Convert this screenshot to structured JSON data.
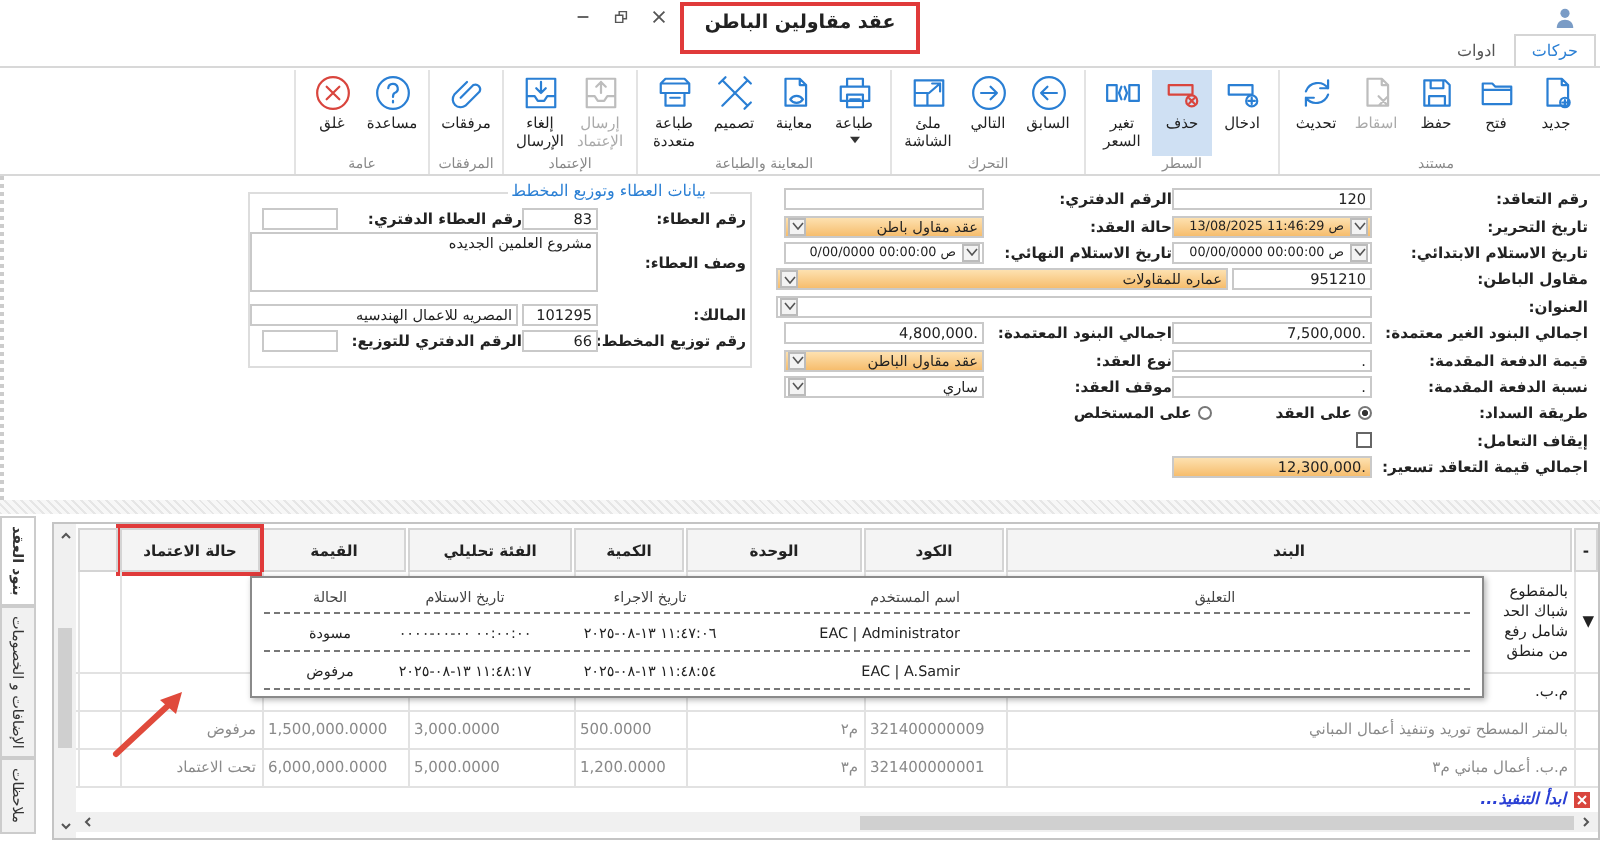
{
  "window": {
    "title": "عقد مقاولين الباطن",
    "annotated": true
  },
  "tabs": [
    {
      "label": "حركات",
      "selected": true
    },
    {
      "label": "ادوات",
      "selected": false
    }
  ],
  "ribbon": [
    {
      "label": "مستند",
      "buttons": [
        {
          "kind": "new",
          "label": "جديد",
          "selected": false,
          "disabled": false,
          "dropdown": false
        },
        {
          "kind": "open",
          "label": "فتح",
          "selected": false,
          "disabled": false,
          "dropdown": false
        },
        {
          "kind": "save",
          "label": "حفظ",
          "selected": false,
          "disabled": false,
          "dropdown": false
        },
        {
          "kind": "drop",
          "label": "اسقاط",
          "selected": false,
          "disabled": true,
          "dropdown": false
        },
        {
          "kind": "refresh",
          "label": "تحديث",
          "selected": false,
          "disabled": false,
          "dropdown": false
        }
      ]
    },
    {
      "label": "السطر",
      "buttons": [
        {
          "kind": "insert",
          "label": "ادخال",
          "selected": false,
          "disabled": false,
          "dropdown": false
        },
        {
          "kind": "delete",
          "label": "حذف",
          "selected": true,
          "disabled": false,
          "dropdown": false
        },
        {
          "kind": "reprice",
          "label": "تغير السعر",
          "selected": false,
          "disabled": false,
          "dropdown": false
        }
      ]
    },
    {
      "label": "التحرك",
      "buttons": [
        {
          "kind": "prev",
          "label": "السابق",
          "selected": false,
          "disabled": false,
          "dropdown": false
        },
        {
          "kind": "next",
          "label": "التالي",
          "selected": false,
          "disabled": false,
          "dropdown": false
        },
        {
          "kind": "fullscreen",
          "label": "ملئ الشاشة",
          "selected": false,
          "disabled": false,
          "dropdown": false
        }
      ]
    },
    {
      "label": "المعاينة والطباعة",
      "buttons": [
        {
          "kind": "print",
          "label": "طباعة",
          "selected": false,
          "disabled": false,
          "dropdown": true
        },
        {
          "kind": "preview",
          "label": "معاينة",
          "selected": false,
          "disabled": false,
          "dropdown": false
        },
        {
          "kind": "design",
          "label": "تصميم",
          "selected": false,
          "disabled": false,
          "dropdown": false
        },
        {
          "kind": "multiprint",
          "label": "طباعة متعددة",
          "selected": false,
          "disabled": false,
          "dropdown": false
        }
      ]
    },
    {
      "label": "الإعتماد",
      "buttons": [
        {
          "kind": "send",
          "label": "إرسال الإعتماد",
          "selected": false,
          "disabled": true,
          "dropdown": false
        },
        {
          "kind": "unsend",
          "label": "إلغاء الإرسال",
          "selected": false,
          "disabled": false,
          "dropdown": false
        }
      ]
    },
    {
      "label": "المرفقات",
      "buttons": [
        {
          "kind": "attach",
          "label": "مرفقات",
          "selected": false,
          "disabled": false,
          "dropdown": false
        }
      ]
    },
    {
      "label": "عامة",
      "buttons": [
        {
          "kind": "help",
          "label": "مساعدة",
          "selected": false,
          "disabled": false,
          "dropdown": false
        },
        {
          "kind": "close",
          "label": "غلق",
          "selected": false,
          "disabled": false,
          "dropdown": false
        }
      ]
    }
  ],
  "contract_form": {
    "rows": [
      [
        {
          "label": "رقم التعاقد:",
          "fields": [
            {
              "kind": "text",
              "value": "120",
              "required": false
            }
          ]
        },
        {
          "label": "الرقم الدفتري:",
          "fields": [
            {
              "kind": "text",
              "required": false
            }
          ]
        }
      ],
      [
        {
          "label": "تاريخ التحرير:",
          "fields": [
            {
              "kind": "date",
              "value": "13/08/2025 11:46:29 ص",
              "required": true
            }
          ]
        },
        {
          "label": "حالة العقد:",
          "fields": [
            {
              "kind": "select",
              "value": "عقد مقاول باطن",
              "required": true
            }
          ]
        }
      ],
      [
        {
          "label": "تاريخ الاستلام الابتدائي:",
          "fields": [
            {
              "kind": "date",
              "value": "00/00/0000 00:00:00 ص",
              "required": false
            }
          ]
        },
        {
          "label": "تاريخ الاستلام النهائي:",
          "fields": [
            {
              "kind": "date",
              "value": "0/00/0000 00:00:00 ص",
              "required": false
            }
          ]
        }
      ],
      [
        {
          "label": "مقاول الباطن:",
          "fields": [
            {
              "kind": "text",
              "value": "951210",
              "required": false
            },
            {
              "kind": "select",
              "value": "عماره للمقاولات",
              "required": true
            }
          ]
        }
      ],
      [
        {
          "label": "العنوان:",
          "fields": [
            {
              "kind": "select",
              "required": false
            }
          ]
        }
      ],
      [
        {
          "label": "اجمالي البنود الغير معتمدة:",
          "fields": [
            {
              "kind": "text",
              "value": "7,500,000.",
              "required": false
            }
          ]
        },
        {
          "label": "اجمالي البنود المعتمدة:",
          "fields": [
            {
              "kind": "text",
              "value": "4,800,000.",
              "required": false
            }
          ]
        }
      ],
      [
        {
          "label": "قيمة الدفعة المقدمة:",
          "fields": [
            {
              "kind": "text",
              "value": ".",
              "required": false
            }
          ]
        },
        {
          "label": "نوع العقد:",
          "fields": [
            {
              "kind": "select",
              "value": "عقد مقاول الباطن",
              "required": true
            }
          ]
        }
      ],
      [
        {
          "label": "نسبة الدفعة المقدمة:",
          "fields": [
            {
              "kind": "text",
              "value": ".",
              "required": false
            }
          ]
        },
        {
          "label": "موقف العقد:",
          "fields": [
            {
              "kind": "select",
              "value": "ساري",
              "required": false
            }
          ]
        }
      ],
      [
        {
          "label": "طريقة السداد:",
          "fields": [
            {
              "kind": "radio",
              "option": "على العقد",
              "selected": true
            },
            {
              "kind": "radio",
              "option": "على المستخلص",
              "selected": false
            }
          ]
        }
      ],
      [
        {
          "label": "إيقاف التعامل:",
          "fields": [
            {
              "kind": "checkbox",
              "checked": false
            }
          ]
        }
      ],
      [
        {
          "label": "اجمالي قيمة التعاقد تسعير:",
          "fields": [
            {
              "kind": "text",
              "value": "12,300,000.",
              "required": true
            }
          ]
        }
      ]
    ]
  },
  "bid_section": {
    "legend": "بيانات العطاء وتوزيع المخطط",
    "rows": [
      [
        {
          "label": "رقم العطاء:",
          "fields": [
            {
              "kind": "text",
              "value": "83",
              "required": false
            }
          ]
        },
        {
          "label": "رقم العطاء الدفتري:",
          "fields": [
            {
              "kind": "text",
              "required": false
            }
          ]
        }
      ],
      [
        {
          "label": "وصف العطاء:",
          "fields": [
            {
              "kind": "textarea",
              "value": "مشروع العلمين الجديده",
              "required": false
            }
          ]
        }
      ],
      [
        {
          "label": "المالك:",
          "fields": [
            {
              "kind": "text",
              "value": "101295",
              "required": false
            },
            {
              "kind": "text",
              "value": "المصريه للاعمال الهندسيه",
              "required": false
            }
          ]
        }
      ],
      [
        {
          "label": "رقم توزيع المخطط:",
          "fields": [
            {
              "kind": "text",
              "value": "66",
              "required": false
            }
          ]
        },
        {
          "label": "الرقم الدفتري للتوزيع:",
          "fields": [
            {
              "kind": "text",
              "required": false
            }
          ]
        }
      ]
    ]
  },
  "grid": {
    "columns": [
      {
        "label": "-",
        "annotated": false
      },
      {
        "label": "البند",
        "annotated": false
      },
      {
        "label": "الكود",
        "annotated": false
      },
      {
        "label": "الوحدة",
        "annotated": false
      },
      {
        "label": "الكمية",
        "annotated": false
      },
      {
        "label": "الفئة تحليلي",
        "annotated": false
      },
      {
        "label": "القيمة",
        "annotated": false
      },
      {
        "label": "حالة الاعتماد",
        "annotated": true
      }
    ],
    "rows": [
      {
        "expander": "▼",
        "item": "بالمقطوع\nشباك الحد\nشامل رفع\nمن منطق"
      },
      {
        "item": "م.ب."
      },
      {
        "item": "بالمتر المسطح توريد وتنفيذ أعمال المباني",
        "code": "321400000009",
        "unit": "م٢",
        "quantity": "500.0000",
        "rate": "3,000.0000",
        "value": "1,500,000.0000",
        "approval_status": "مرفوض"
      },
      {
        "item": "م.ب. أعمال مباني م٣",
        "code": "321400000001",
        "unit": "م٣",
        "quantity": "1,200.0000",
        "rate": "5,000.0000",
        "value": "6,000,000.0000",
        "approval_status": "تحت الاعتماد"
      }
    ],
    "footer_link": "ابدأ التنفيذ..."
  },
  "approval_history": {
    "columns": [
      "التعليق",
      "اسم المستخدم",
      "تاريخ الاجراء",
      "تاريخ الاستلام",
      "الحالة"
    ],
    "rows": [
      {
        "user": "EAC | Administrator",
        "action_date": "٢٠٢٥-٠٨-١٣ ١١:٤٧:٠٦",
        "receipt_date": "٠٠٠٠-٠٠-٠٠ ٠٠:٠٠:٠٠",
        "status": "مسودة"
      },
      {
        "user": "EAC | A.Samir",
        "action_date": "٢٠٢٥-٠٨-١٣ ١١:٤٨:٥٤",
        "receipt_date": "٢٠٢٥-٠٨-١٣ ١١:٤٨:١٧",
        "status": "مرفوض"
      }
    ]
  },
  "side_tabs": [
    {
      "label": "بنود العقد",
      "selected": true
    },
    {
      "label": "الإضافات و الخصومات",
      "selected": false
    },
    {
      "label": "ملاحظات",
      "selected": false
    }
  ]
}
